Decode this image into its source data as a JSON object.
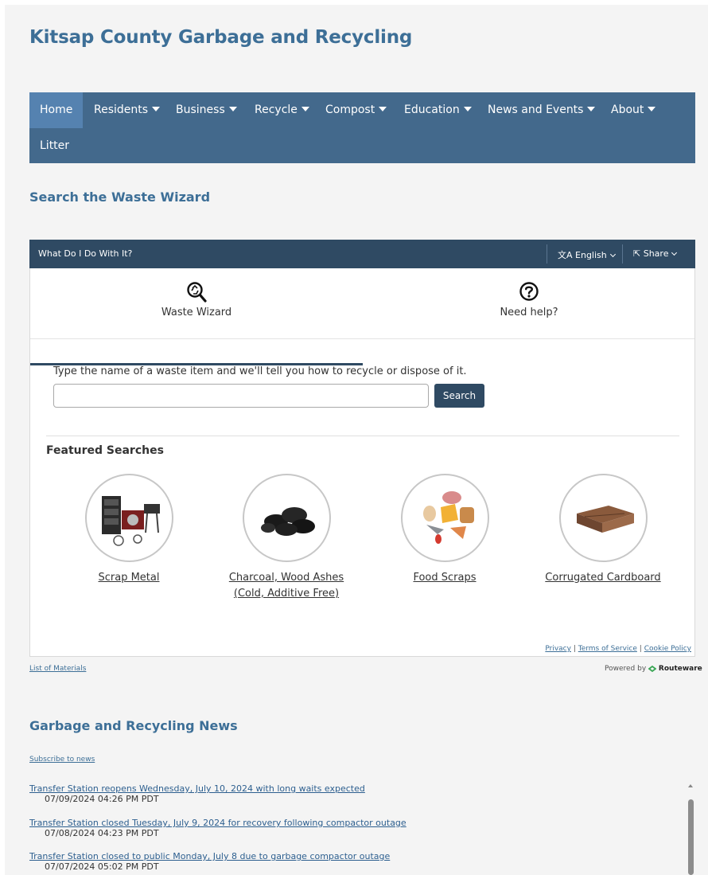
{
  "site": {
    "title": "Kitsap County Garbage and Recycling"
  },
  "nav": {
    "items": [
      {
        "label": "Home",
        "dropdown": false,
        "active": true
      },
      {
        "label": "Residents",
        "dropdown": true
      },
      {
        "label": "Business",
        "dropdown": true
      },
      {
        "label": "Recycle",
        "dropdown": true
      },
      {
        "label": "Compost",
        "dropdown": true
      },
      {
        "label": "Education",
        "dropdown": true
      },
      {
        "label": "News and Events",
        "dropdown": true
      },
      {
        "label": "About",
        "dropdown": true
      },
      {
        "label": "Litter",
        "dropdown": false
      }
    ]
  },
  "waste_wizard_section": {
    "heading": "Search the Waste Wizard"
  },
  "widget": {
    "header_title": "What Do I Do With It?",
    "language_label": "English",
    "share_label": "Share",
    "tabs": [
      {
        "label": "Waste Wizard",
        "icon": "recycle-search-icon",
        "active": true
      },
      {
        "label": "Need help?",
        "icon": "question-circle-icon",
        "active": false
      }
    ],
    "prompt": "Type the name of a waste item and we'll tell you how to recycle or dispose of it.",
    "search_value": "",
    "search_button": "Search",
    "featured_heading": "Featured Searches",
    "featured": [
      {
        "label": "Scrap Metal",
        "icon": "scrap-metal-image"
      },
      {
        "label": "Charcoal, Wood Ashes (Cold, Additive Free)",
        "icon": "charcoal-image"
      },
      {
        "label": "Food Scraps",
        "icon": "food-scraps-image"
      },
      {
        "label": "Corrugated Cardboard",
        "icon": "cardboard-image"
      }
    ],
    "legal": {
      "privacy": "Privacy",
      "terms": "Terms of Service",
      "cookie": "Cookie Policy",
      "separator": "|"
    }
  },
  "footer_widget": {
    "list_of_materials": "List of Materials",
    "powered_by": "Powered by",
    "brand": "Routeware"
  },
  "news": {
    "heading": "Garbage and Recycling News",
    "subscribe": "Subscribe to news",
    "items": [
      {
        "title": "Transfer Station reopens Wednesday, July 10, 2024 with long waits expected",
        "date": "07/09/2024 04:26 PM PDT"
      },
      {
        "title": "Transfer Station closed Tuesday, July 9, 2024 for recovery following compactor outage",
        "date": "07/08/2024 04:23 PM PDT"
      },
      {
        "title": "Transfer Station closed to public Monday, July 8 due to garbage compactor outage",
        "date": "07/07/2024 05:02 PM PDT"
      }
    ]
  },
  "colors": {
    "brand_blue": "#3d6f97",
    "nav_bg": "#43698c",
    "nav_active": "#5582b0",
    "widget_header": "#2f4a63"
  }
}
